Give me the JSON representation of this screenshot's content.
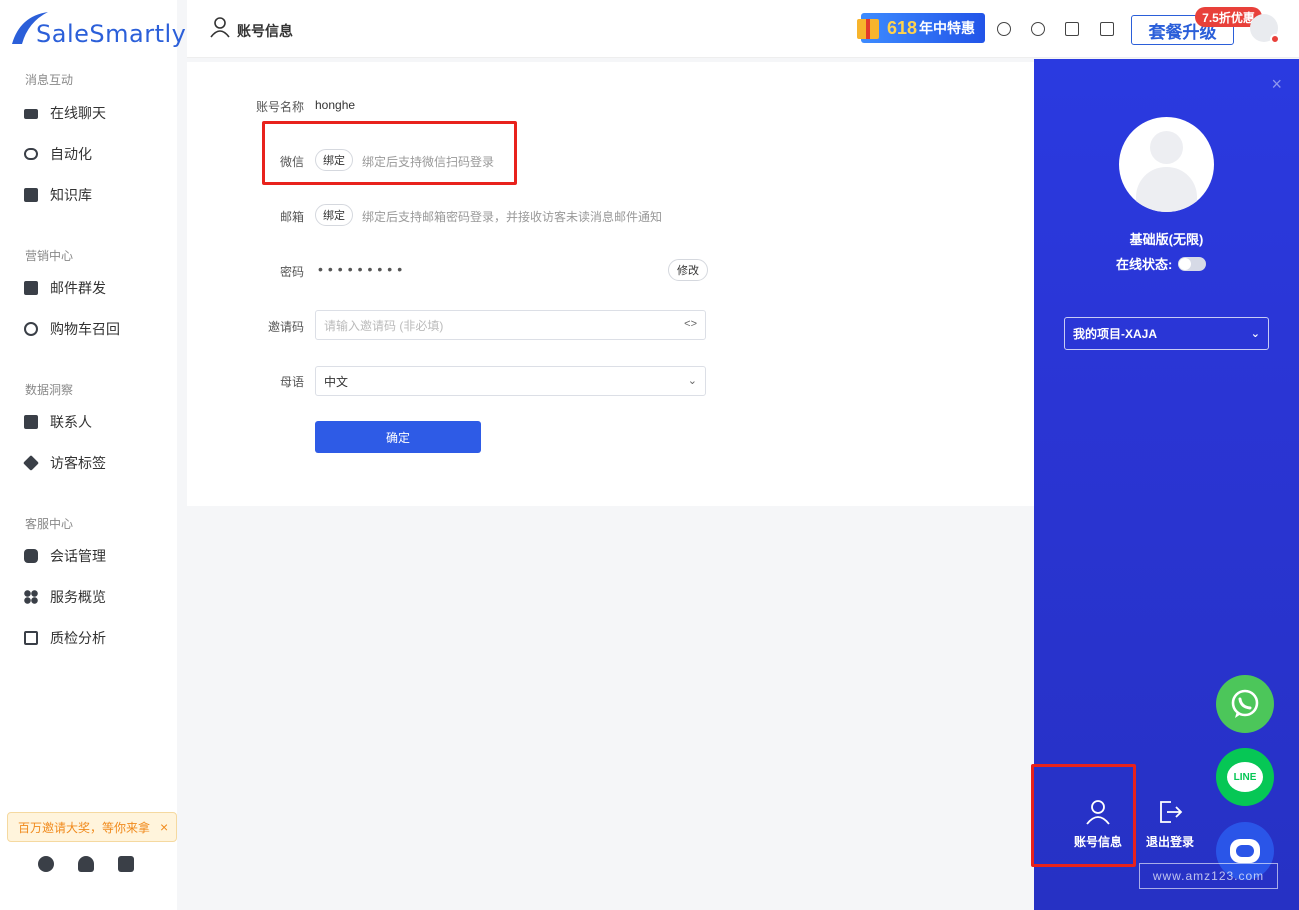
{
  "brand": {
    "name": "SaleSmartly"
  },
  "sidebar": {
    "sections": [
      {
        "title": "消息互动",
        "items": [
          {
            "label": "在线聊天",
            "icon": "chat-icon"
          },
          {
            "label": "自动化",
            "icon": "robot-icon"
          },
          {
            "label": "知识库",
            "icon": "book-icon"
          }
        ]
      },
      {
        "title": "营销中心",
        "items": [
          {
            "label": "邮件群发",
            "icon": "gift-icon"
          },
          {
            "label": "购物车召回",
            "icon": "cart-recall-icon"
          }
        ]
      },
      {
        "title": "数据洞察",
        "items": [
          {
            "label": "联系人",
            "icon": "contact-icon"
          },
          {
            "label": "访客标签",
            "icon": "tag-icon"
          }
        ]
      },
      {
        "title": "客服中心",
        "items": [
          {
            "label": "会话管理",
            "icon": "session-icon"
          },
          {
            "label": "服务概览",
            "icon": "overview-icon"
          },
          {
            "label": "质检分析",
            "icon": "chart-icon"
          }
        ]
      }
    ],
    "promo": {
      "text": "百万邀请大奖，等你来拿",
      "close": "×"
    }
  },
  "header": {
    "title": "账号信息",
    "promo_num": "618",
    "promo_text": "年中特惠",
    "upgrade": "套餐升级",
    "discount": "7.5折优惠"
  },
  "form": {
    "account_label": "账号名称",
    "account_value": "honghe",
    "wechat_label": "微信",
    "wechat_btn": "绑定",
    "wechat_hint": "绑定后支持微信扫码登录",
    "email_label": "邮箱",
    "email_btn": "绑定",
    "email_hint": "绑定后支持邮箱密码登录，并接收访客未读消息邮件通知",
    "password_label": "密码",
    "password_mask": "•••••••••",
    "password_btn": "修改",
    "invite_label": "邀请码",
    "invite_placeholder": "请输入邀请码 (非必填)",
    "invite_suffix": "<>",
    "lang_label": "母语",
    "lang_value": "中文",
    "confirm": "确定"
  },
  "panel": {
    "close": "×",
    "plan": "基础版(无限)",
    "status_label": "在线状态:",
    "project": "我的项目-XAJA",
    "account_btn": "账号信息",
    "logout_btn": "退出登录"
  },
  "fabs": {
    "line": "LINE"
  },
  "watermark": "www.amz123.com",
  "colors": {
    "primary": "#2e5be6",
    "panel": "#2a3ae0",
    "highlight": "#e8221c",
    "whatsapp": "#4cc65a",
    "line": "#06c755"
  }
}
